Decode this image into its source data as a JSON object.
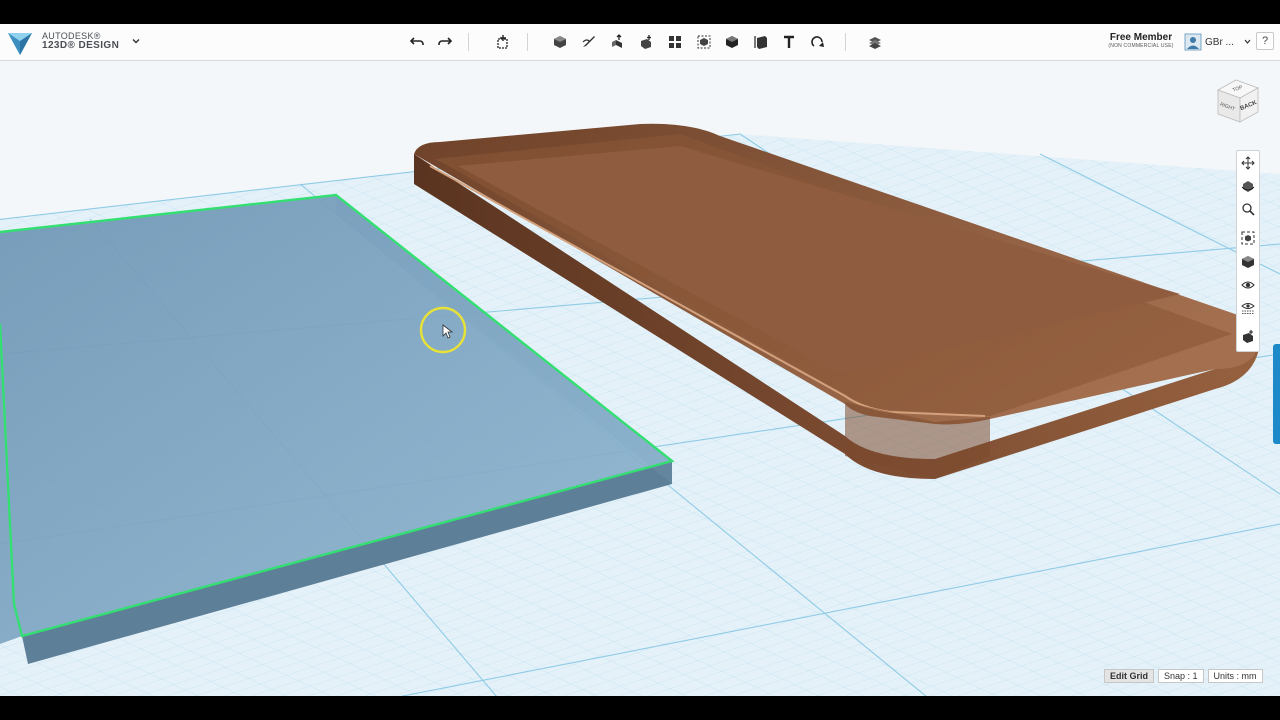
{
  "app": {
    "brand_line1": "AUTODESK®",
    "brand_line2": "123D® DESIGN",
    "menu_caret_icon": "chevron-down-icon"
  },
  "toolbar": {
    "groups": [
      [
        "undo-icon",
        "redo-icon"
      ],
      [
        "transform-icon"
      ],
      [
        "primitives-icon",
        "sketch-icon",
        "construct-icon",
        "modify-icon",
        "pattern-icon",
        "group-icon",
        "combine-icon",
        "measure-icon",
        "text-icon",
        "snap-icon"
      ],
      [
        "material-icon"
      ]
    ]
  },
  "account": {
    "membership": "Free Member",
    "membership_note": "(NON COMMERCIAL USE)",
    "user_name": "GBr ...",
    "help_label": "?"
  },
  "viewcube": {
    "face_top": "TOP",
    "face_front": "RIGHT",
    "face_side": "BACK"
  },
  "nav_tools": [
    "pan-icon",
    "orbit-icon",
    "zoom-icon",
    "fit-icon",
    "views-icon",
    "visibility-icon",
    "material-view-icon",
    "grid-view-icon"
  ],
  "status": {
    "edit_grid": "Edit Grid",
    "snap": "Snap : 1",
    "units": "Units : mm"
  },
  "colors": {
    "grid_bg": "#e5f1f8",
    "grid_line": "#9dd0e8",
    "plate_fill": "#7fa6c2",
    "plate_edge_highlight": "#34df72",
    "case_fill": "#8d5a3c",
    "cursor_ring": "#e8e237",
    "accent": "#1c89c8"
  }
}
